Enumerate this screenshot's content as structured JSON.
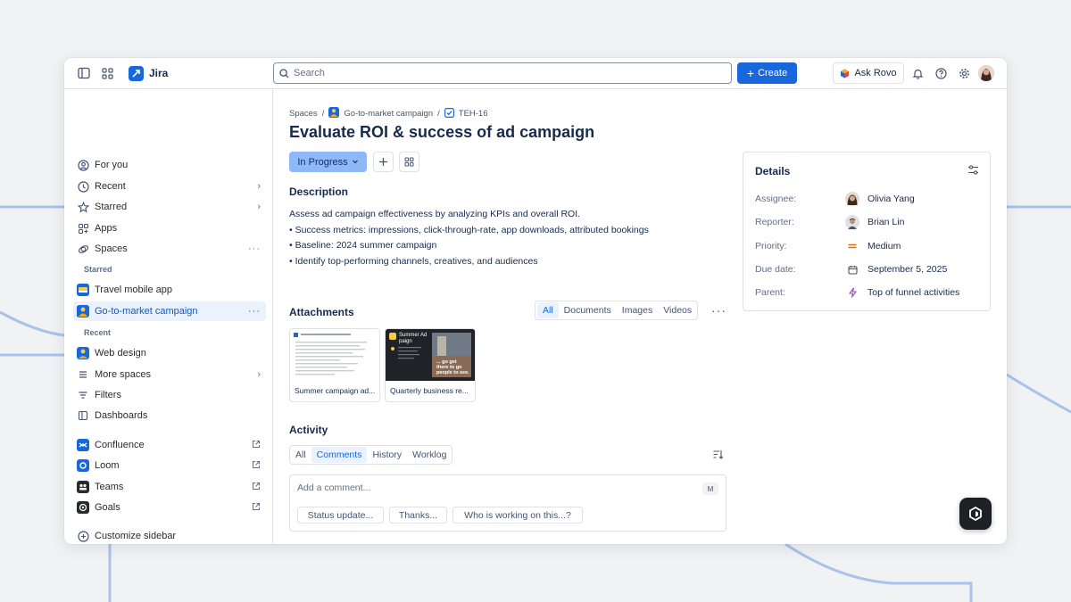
{
  "app": {
    "name": "Jira"
  },
  "topbar": {
    "search_placeholder": "Search",
    "create_label": "Create",
    "rovo_label": "Ask Rovo"
  },
  "sidebar": {
    "items": [
      {
        "label": "For you",
        "icon": "user-circle-icon"
      },
      {
        "label": "Recent",
        "icon": "clock-icon"
      },
      {
        "label": "Starred",
        "icon": "star-icon"
      },
      {
        "label": "Apps",
        "icon": "apps-icon"
      },
      {
        "label": "Spaces",
        "icon": "spaces-icon"
      }
    ],
    "starred_heading": "Starred",
    "starred_spaces": [
      {
        "label": "Travel mobile app"
      },
      {
        "label": "Go-to-market campaign"
      }
    ],
    "recent_heading": "Recent",
    "recent_spaces": [
      {
        "label": "Web design"
      },
      {
        "label": "More spaces"
      }
    ],
    "bottom_items": [
      {
        "label": "Filters"
      },
      {
        "label": "Dashboards"
      }
    ],
    "apps": [
      {
        "label": "Confluence",
        "color": "#1868db"
      },
      {
        "label": "Loom",
        "color": "#1868db"
      },
      {
        "label": "Teams",
        "color": "#292a2e"
      },
      {
        "label": "Goals",
        "color": "#292a2e"
      }
    ],
    "customize_label": "Customize sidebar"
  },
  "breadcrumb": {
    "root": "Spaces",
    "space": "Go-to-market campaign",
    "issue_key": "TEH-16"
  },
  "issue": {
    "title": "Evaluate ROI & success of ad campaign",
    "status": "In Progress",
    "description_heading": "Description",
    "description_lines": [
      "Assess ad campaign effectiveness by analyzing KPIs and overall ROI.",
      "• Success metrics: impressions, click-through-rate, app downloads, attributed bookings",
      "• Baseline: 2024 summer campaign",
      "• Identify top-performing channels, creatives, and audiences"
    ]
  },
  "attachments": {
    "heading": "Attachments",
    "tabs": [
      "All",
      "Documents",
      "Images",
      "Videos"
    ],
    "files": [
      {
        "name": "Summer campaign ad..."
      },
      {
        "name": "Quarterly business re..."
      }
    ],
    "thumb_text": "Summer Ad\npaign",
    "thumb_overlay": "... go get\nthere to go\npeople to see."
  },
  "activity": {
    "heading": "Activity",
    "tabs": [
      "All",
      "Comments",
      "History",
      "Worklog"
    ],
    "comment_placeholder": "Add a comment...",
    "shortcut_key": "M",
    "quick_replies": [
      "Status update...",
      "Thanks...",
      "Who is working on this...?"
    ]
  },
  "details": {
    "heading": "Details",
    "rows": [
      {
        "label": "Assignee:",
        "value": "Olivia Yang"
      },
      {
        "label": "Reporter:",
        "value": "Brian Lin"
      },
      {
        "label": "Priority:",
        "value": "Medium"
      },
      {
        "label": "Due date:",
        "value": "September 5, 2025"
      },
      {
        "label": "Parent:",
        "value": "Top of funnel activities"
      }
    ]
  },
  "colors": {
    "brand": "#1868db",
    "status_bg": "#8fb8f6",
    "priority_medium": "#d97008",
    "parent_lightning": "#964ac0"
  }
}
